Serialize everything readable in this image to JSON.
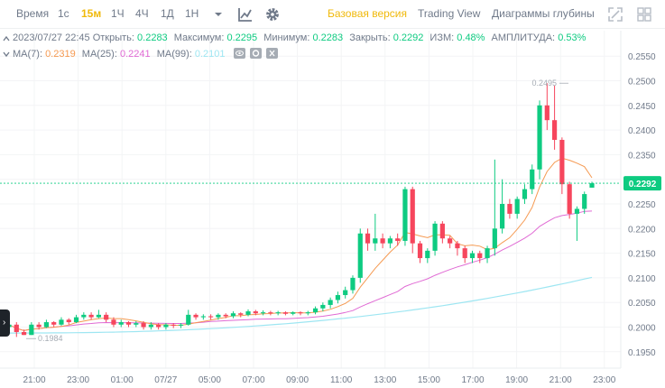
{
  "toolbar": {
    "time_label": "Время",
    "intervals": [
      {
        "label": "1с",
        "active": false
      },
      {
        "label": "15м",
        "active": true
      },
      {
        "label": "1Ч",
        "active": false
      },
      {
        "label": "4Ч",
        "active": false
      },
      {
        "label": "1Д",
        "active": false
      },
      {
        "label": "1Н",
        "active": false
      }
    ],
    "icons": [
      "chevron-down-icon",
      "indicators-icon",
      "settings-icon",
      "fullscreen-icon",
      "grid-icon"
    ],
    "views": [
      {
        "label": "Базовая версия",
        "active": true
      },
      {
        "label": "Trading View",
        "active": false
      },
      {
        "label": "Диаграммы глубины",
        "active": false
      }
    ]
  },
  "info": {
    "datetime": "2023/07/27 22:45",
    "open_label": "Открыть:",
    "open": "0.2283",
    "high_label": "Максимум:",
    "high": "0.2295",
    "low_label": "Минимум:",
    "low": "0.2283",
    "close_label": "Закрыть:",
    "close": "0.2292",
    "change_label": "ИЗМ:",
    "change": "0.48%",
    "amplitude_label": "АМПЛИТУДА:",
    "amplitude": "0.53%"
  },
  "ma": {
    "ma7_label": "MA(7):",
    "ma7": "0.2319",
    "ma25_label": "MA(25):",
    "ma25": "0.2241",
    "ma99_label": "MA(99):",
    "ma99": "0.2101"
  },
  "colors": {
    "up": "#0ecb81",
    "down": "#f6465d",
    "accent": "#f0b90b",
    "ma7": "#f59a52",
    "ma25": "#e06ad4",
    "ma99": "#9ee6f2"
  },
  "chart_data": {
    "type": "candlestick",
    "y_ticks": [
      "0.2550",
      "0.2500",
      "0.2450",
      "0.2400",
      "0.2350",
      "0.2300",
      "0.2250",
      "0.2200",
      "0.2150",
      "0.2100",
      "0.2050",
      "0.2000",
      "0.1950"
    ],
    "x_ticks": [
      "21:00",
      "23:00",
      "01:00",
      "07/27",
      "05:00",
      "07:00",
      "09:00",
      "11:00",
      "13:00",
      "15:00",
      "17:00",
      "19:00",
      "21:00",
      "23:00"
    ],
    "ylim": [
      0.1935,
      0.2565
    ],
    "current_price": "0.2292",
    "high_marker": "0.2495",
    "low_marker": "0.1984",
    "candles": [
      [
        0.2,
        0.2005,
        0.1995,
        0.201,
        0.199
      ],
      [
        0.2005,
        0.199,
        0.1985,
        0.201,
        0.198
      ],
      [
        0.199,
        0.1984,
        0.198,
        0.1995,
        0.1984
      ],
      [
        0.1984,
        0.2005,
        0.199,
        0.201,
        0.1984
      ],
      [
        0.2005,
        0.2,
        0.1995,
        0.201,
        0.1995
      ],
      [
        0.2,
        0.201,
        0.2,
        0.2015,
        0.1998
      ],
      [
        0.201,
        0.2005,
        0.2003,
        0.2012,
        0.2
      ],
      [
        0.2005,
        0.2015,
        0.2005,
        0.202,
        0.2003
      ],
      [
        0.2015,
        0.201,
        0.2008,
        0.2018,
        0.2005
      ],
      [
        0.201,
        0.202,
        0.201,
        0.2025,
        0.2008
      ],
      [
        0.202,
        0.2025,
        0.2018,
        0.203,
        0.2015
      ],
      [
        0.2025,
        0.202,
        0.2018,
        0.203,
        0.2015
      ],
      [
        0.202,
        0.2025,
        0.202,
        0.2035,
        0.2018
      ],
      [
        0.2025,
        0.2015,
        0.2012,
        0.203,
        0.201
      ],
      [
        0.2015,
        0.2005,
        0.2003,
        0.202,
        0.2
      ],
      [
        0.2005,
        0.201,
        0.2003,
        0.2015,
        0.2
      ],
      [
        0.201,
        0.2005,
        0.2003,
        0.2012,
        0.2
      ],
      [
        0.2005,
        0.2008,
        0.2002,
        0.2012,
        0.2
      ],
      [
        0.2008,
        0.2,
        0.1998,
        0.2012,
        0.1995
      ],
      [
        0.2,
        0.2005,
        0.1998,
        0.201,
        0.1995
      ],
      [
        0.2005,
        0.2,
        0.1998,
        0.2008,
        0.1995
      ],
      [
        0.2,
        0.2005,
        0.1998,
        0.2008,
        0.1995
      ],
      [
        0.2005,
        0.2003,
        0.2,
        0.2008,
        0.1998
      ],
      [
        0.2003,
        0.2005,
        0.2,
        0.2008,
        0.1998
      ],
      [
        0.2005,
        0.2025,
        0.2005,
        0.2035,
        0.2003
      ],
      [
        0.2025,
        0.202,
        0.2018,
        0.2028,
        0.2015
      ],
      [
        0.202,
        0.2022,
        0.2018,
        0.2026,
        0.2015
      ],
      [
        0.2022,
        0.202,
        0.2018,
        0.2026,
        0.2015
      ],
      [
        0.202,
        0.2025,
        0.2018,
        0.2028,
        0.2015
      ],
      [
        0.2025,
        0.2022,
        0.202,
        0.2028,
        0.2018
      ],
      [
        0.2022,
        0.2028,
        0.202,
        0.2032,
        0.2018
      ],
      [
        0.2028,
        0.2025,
        0.2022,
        0.203,
        0.202
      ],
      [
        0.2025,
        0.2032,
        0.2024,
        0.2036,
        0.2022
      ],
      [
        0.2032,
        0.2028,
        0.2025,
        0.2035,
        0.2024
      ],
      [
        0.2028,
        0.203,
        0.2026,
        0.2034,
        0.2024
      ],
      [
        0.203,
        0.2028,
        0.2026,
        0.2033,
        0.2024
      ],
      [
        0.2028,
        0.203,
        0.2026,
        0.2033,
        0.2024
      ],
      [
        0.203,
        0.2027,
        0.2025,
        0.2032,
        0.2024
      ],
      [
        0.2027,
        0.203,
        0.2025,
        0.2032,
        0.2024
      ],
      [
        0.203,
        0.2028,
        0.2026,
        0.2032,
        0.2024
      ],
      [
        0.2028,
        0.203,
        0.2026,
        0.2033,
        0.2024
      ],
      [
        0.203,
        0.2038,
        0.2028,
        0.2042,
        0.2026
      ],
      [
        0.2038,
        0.2045,
        0.2035,
        0.205,
        0.2032
      ],
      [
        0.2045,
        0.2055,
        0.204,
        0.206,
        0.2038
      ],
      [
        0.2055,
        0.2065,
        0.205,
        0.2072,
        0.2048
      ],
      [
        0.2065,
        0.2075,
        0.206,
        0.2082,
        0.2058
      ],
      [
        0.2075,
        0.21,
        0.207,
        0.2105,
        0.2068
      ],
      [
        0.21,
        0.219,
        0.2095,
        0.22,
        0.209
      ],
      [
        0.219,
        0.217,
        0.216,
        0.22,
        0.2155
      ],
      [
        0.217,
        0.218,
        0.216,
        0.223,
        0.2155
      ],
      [
        0.218,
        0.217,
        0.2165,
        0.219,
        0.216
      ],
      [
        0.217,
        0.218,
        0.2165,
        0.2185,
        0.216
      ],
      [
        0.218,
        0.2175,
        0.217,
        0.219,
        0.2165
      ],
      [
        0.2175,
        0.228,
        0.217,
        0.2285,
        0.2165
      ],
      [
        0.228,
        0.217,
        0.216,
        0.2285,
        0.215
      ],
      [
        0.217,
        0.214,
        0.2135,
        0.2175,
        0.213
      ],
      [
        0.214,
        0.2155,
        0.2135,
        0.216,
        0.213
      ],
      [
        0.2155,
        0.221,
        0.215,
        0.2215,
        0.2145
      ],
      [
        0.221,
        0.218,
        0.2175,
        0.2215,
        0.217
      ],
      [
        0.218,
        0.217,
        0.2165,
        0.2185,
        0.216
      ],
      [
        0.217,
        0.216,
        0.215,
        0.2175,
        0.2145
      ],
      [
        0.216,
        0.214,
        0.2135,
        0.2165,
        0.213
      ],
      [
        0.214,
        0.215,
        0.2135,
        0.2155,
        0.213
      ],
      [
        0.215,
        0.214,
        0.2135,
        0.2155,
        0.213
      ],
      [
        0.214,
        0.216,
        0.2135,
        0.2165,
        0.213
      ],
      [
        0.216,
        0.22,
        0.215,
        0.234,
        0.2145
      ],
      [
        0.22,
        0.225,
        0.2195,
        0.23,
        0.219
      ],
      [
        0.225,
        0.223,
        0.2225,
        0.226,
        0.222
      ],
      [
        0.223,
        0.226,
        0.2225,
        0.2265,
        0.222
      ],
      [
        0.226,
        0.228,
        0.2255,
        0.229,
        0.225
      ],
      [
        0.228,
        0.232,
        0.2275,
        0.233,
        0.227
      ],
      [
        0.232,
        0.245,
        0.231,
        0.246,
        0.23
      ],
      [
        0.245,
        0.242,
        0.241,
        0.2495,
        0.24
      ],
      [
        0.242,
        0.238,
        0.237,
        0.249,
        0.236
      ],
      [
        0.238,
        0.229,
        0.228,
        0.2385,
        0.227
      ],
      [
        0.229,
        0.223,
        0.2225,
        0.2295,
        0.222
      ],
      [
        0.223,
        0.224,
        0.218,
        0.2245,
        0.2175
      ],
      [
        0.224,
        0.227,
        0.2235,
        0.2275,
        0.223
      ],
      [
        0.2283,
        0.2292,
        0.2283,
        0.2295,
        0.2283
      ]
    ]
  }
}
